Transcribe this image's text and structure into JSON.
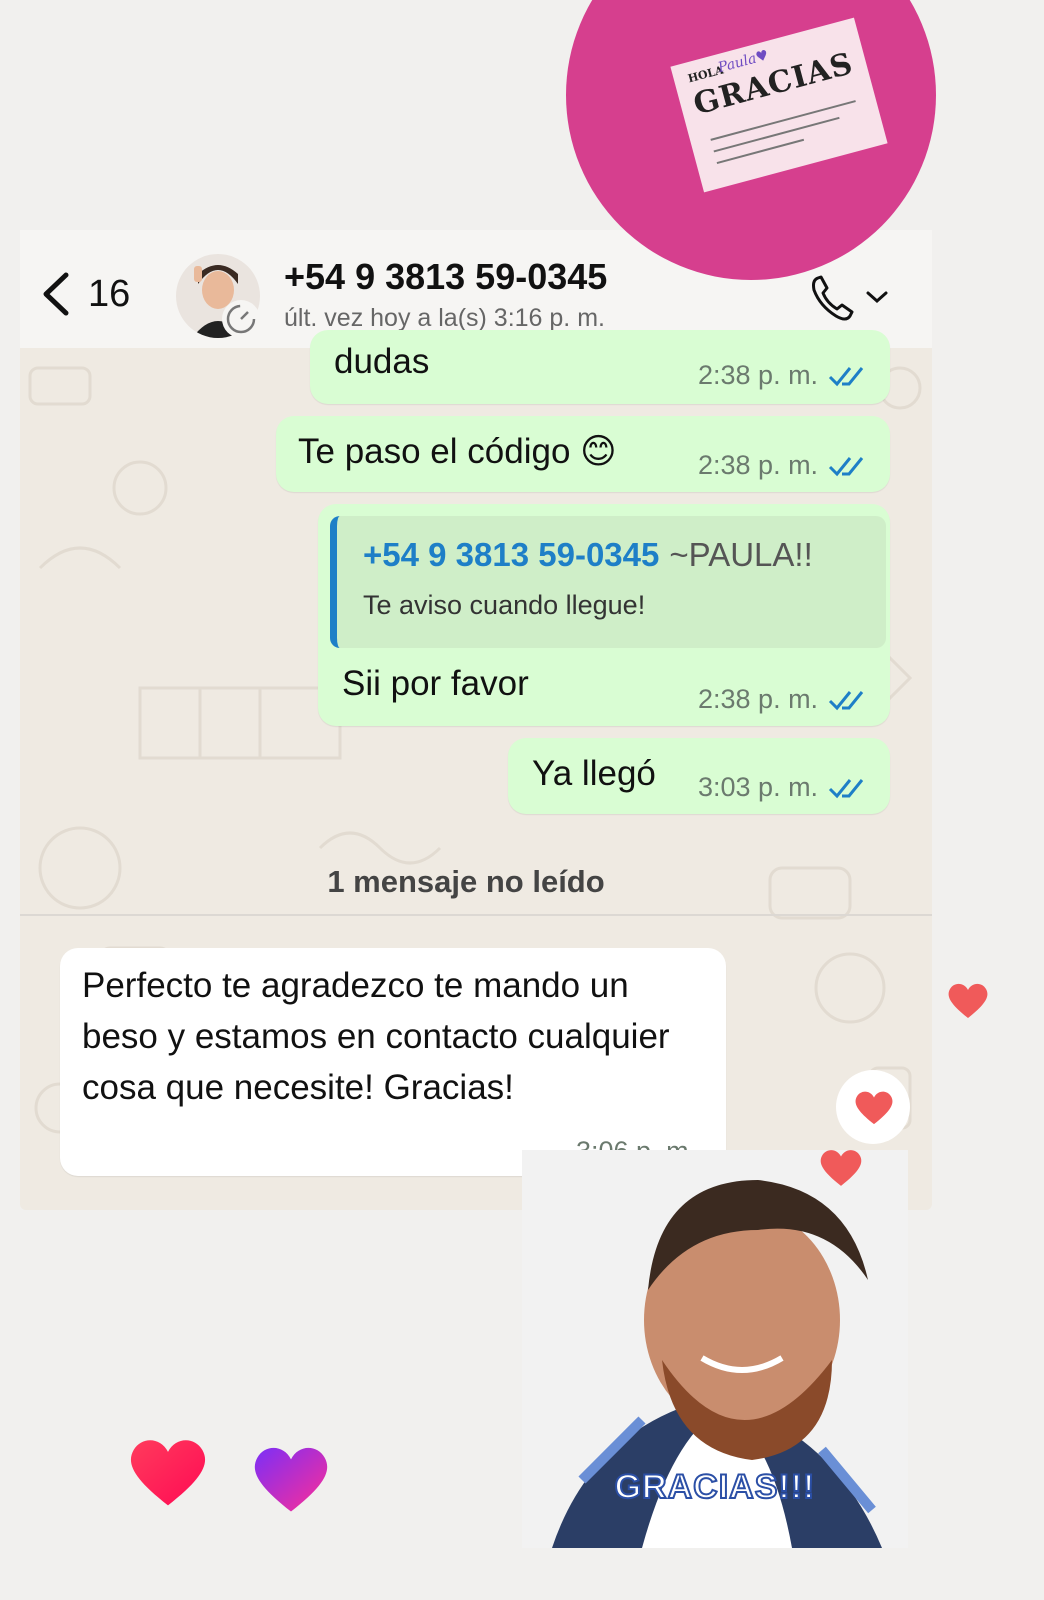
{
  "header": {
    "back_count": "16",
    "contact_name": "+54 9 3813 59-0345",
    "last_seen": "últ. vez hoy a la(s) 3:16 p. m."
  },
  "messages": [
    {
      "direction": "out",
      "text": "dudas",
      "time": "2:38 p. m.",
      "read": true
    },
    {
      "direction": "out",
      "text": "Te paso el código 😊",
      "time": "2:38 p. m.",
      "read": true
    },
    {
      "direction": "out",
      "quote": {
        "author": "+54 9 3813 59-0345",
        "nickname": "~PAULA!!",
        "text": "Te aviso cuando llegue!"
      },
      "text": "Sii por favor",
      "time": "2:38 p. m.",
      "read": true
    },
    {
      "direction": "out",
      "text": "Ya llegó",
      "time": "3:03 p. m.",
      "read": true
    }
  ],
  "unread_divider": "1 mensaje no leído",
  "incoming": {
    "text": "Perfecto te agradezco te mando un beso y estamos en contacto cualquier cosa que necesite! Gracias!",
    "time": "3:06 p. m."
  },
  "stickers": {
    "card_hola": "HOLA",
    "card_name": "Paula♥",
    "card_title": "GRACIAS",
    "photo_caption": "GRACIAS!!!"
  },
  "colors": {
    "outgoing_bubble": "#d9fdd3",
    "incoming_bubble": "#ffffff",
    "read_tick": "#1e7fc7",
    "heart_red": "#ff2d55",
    "heart_purple": "#8a2be2"
  },
  "icons": [
    "back-chevron-icon",
    "call-icon",
    "chevron-down-icon",
    "double-check-icon",
    "heart-icon"
  ]
}
